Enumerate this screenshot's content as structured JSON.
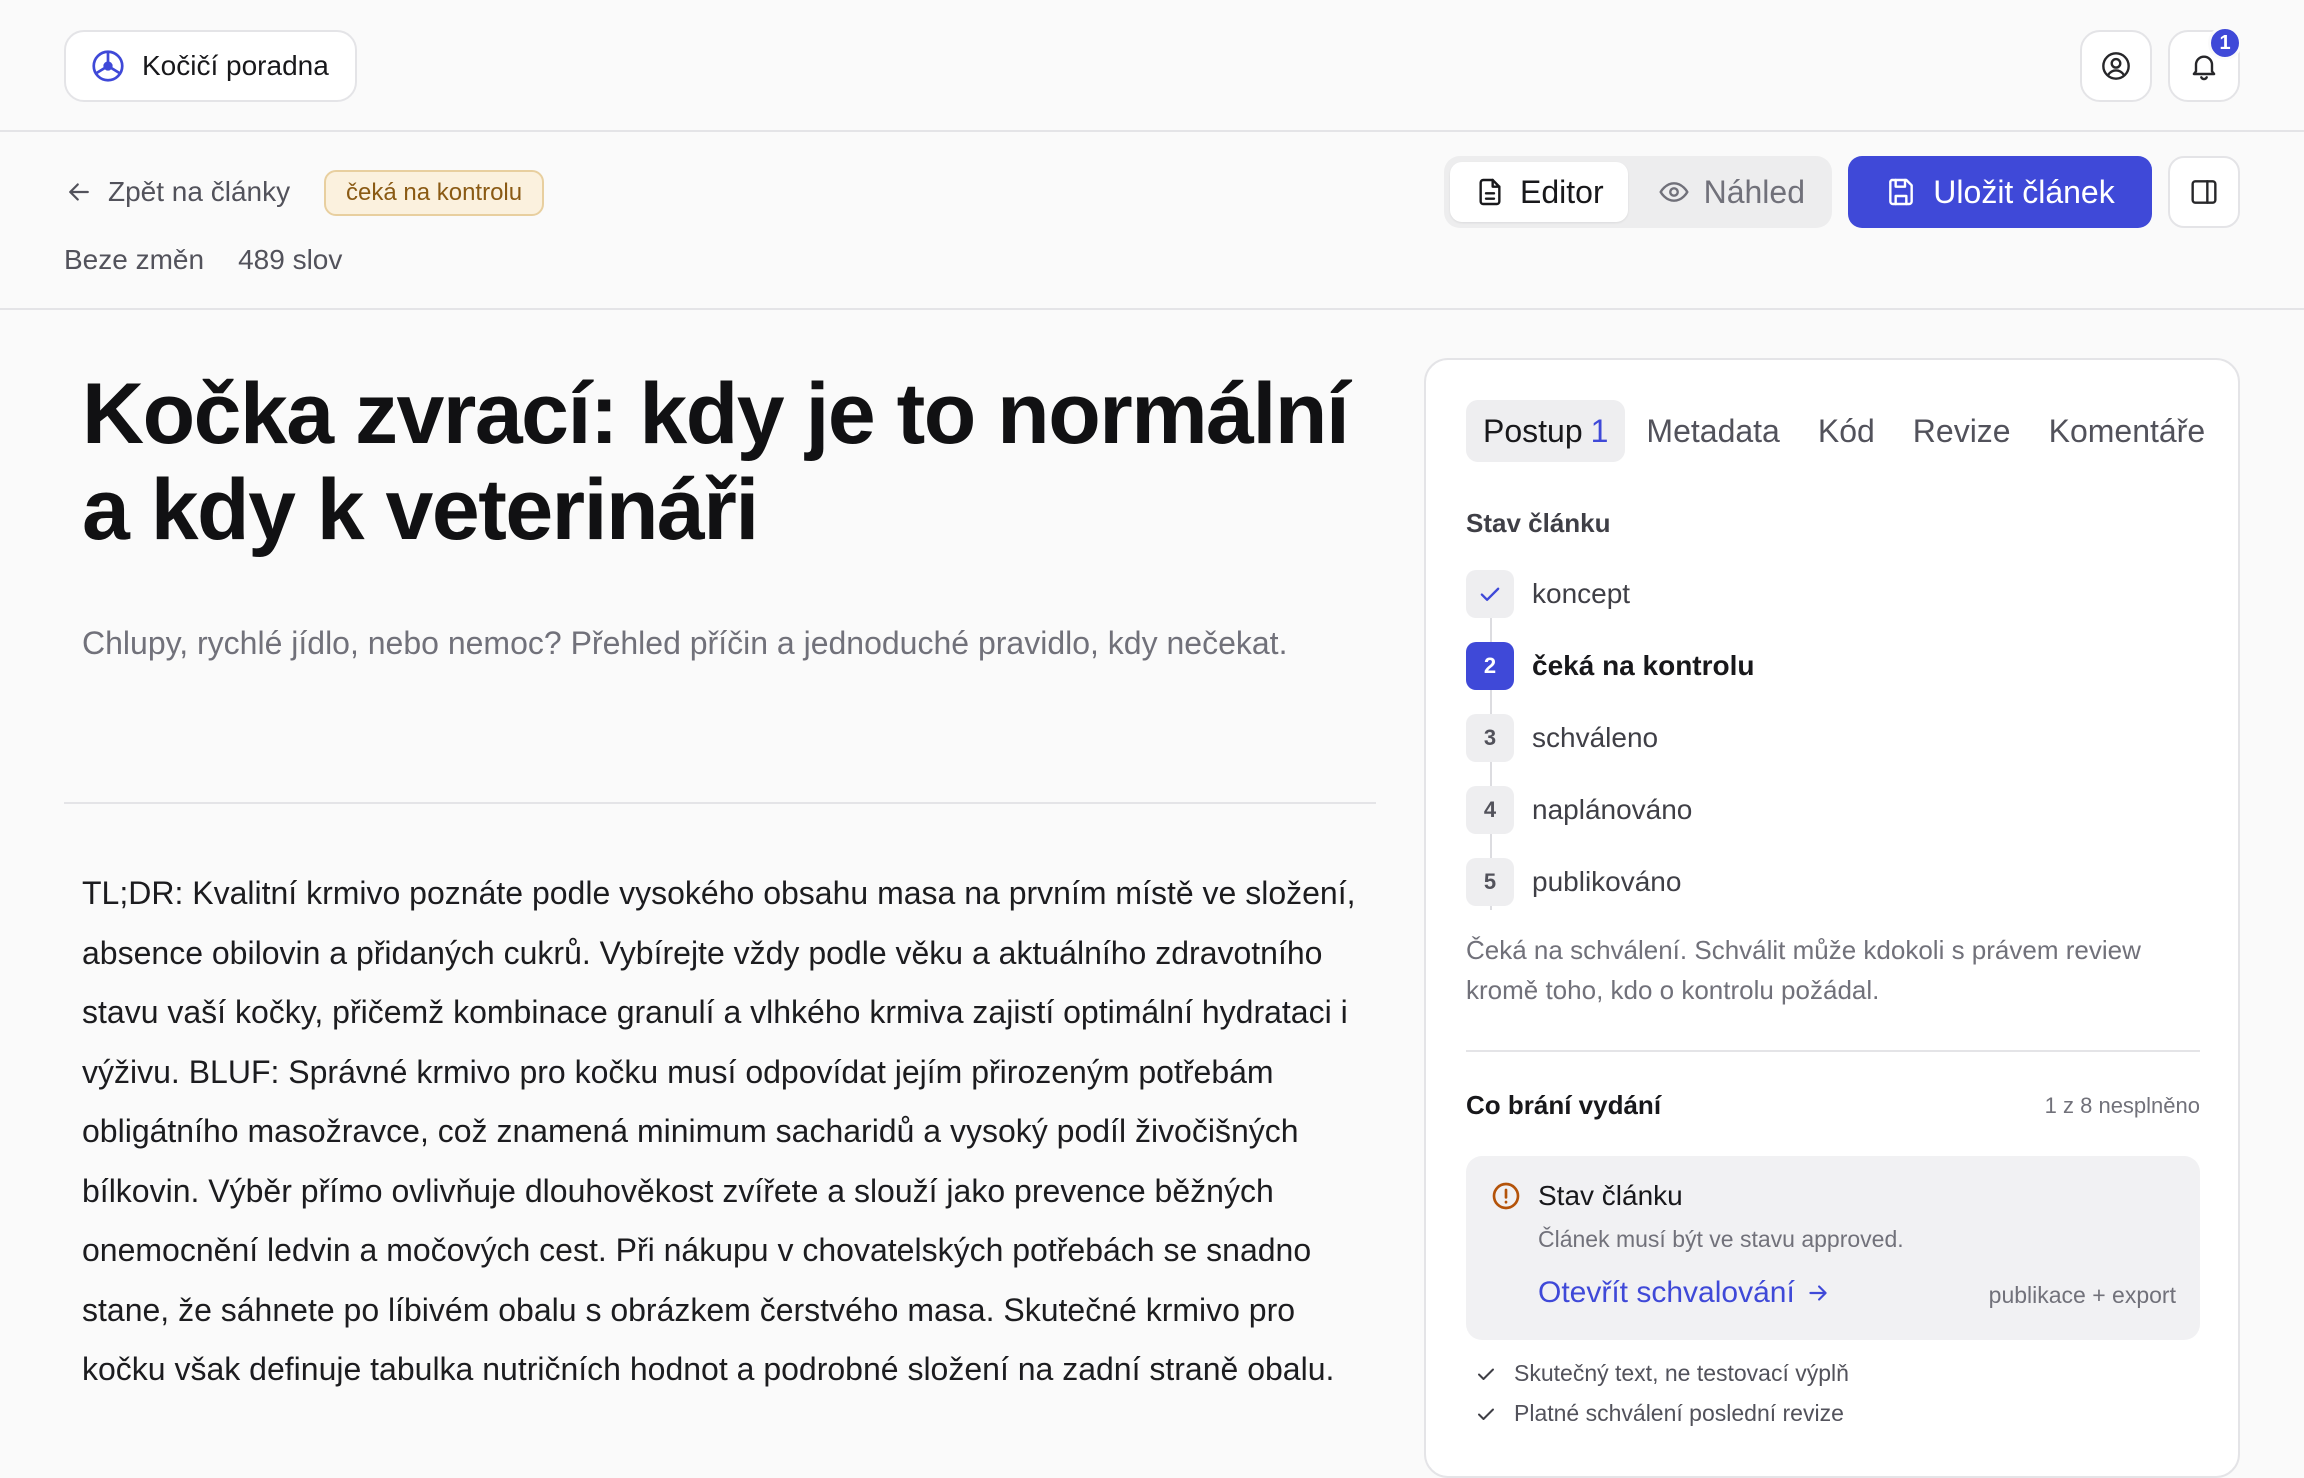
{
  "header": {
    "brand_label": "Kočičí poradna",
    "notification_count": "1"
  },
  "subheader": {
    "back_label": "Zpět na články",
    "status_badge": "čeká na kontrolu",
    "change_status": "Beze změn",
    "word_count": "489 slov",
    "mode_editor": "Editor",
    "mode_preview": "Náhled",
    "save_label": "Uložit článek"
  },
  "article": {
    "title": "Kočka zvrací: kdy je to normální a kdy k veterináři",
    "subtitle": "Chlupy, rychlé jídlo, nebo nemoc? Přehled příčin a jednoduché pravidlo, kdy nečekat.",
    "body": "TL;DR: Kvalitní krmivo poznáte podle vysokého obsahu masa na prvním místě ve složení, absence obilovin a přidaných cukrů. Vybírejte vždy podle věku a aktuálního zdravotního stavu vaší kočky, přičemž kombinace granulí a vlhkého krmiva zajistí optimální hydrataci i výživu. BLUF: Správné krmivo pro kočku musí odpovídat jejím přirozeným potřebám obligátního masožravce, což znamená minimum sacharidů a vysoký podíl živočišných bílkovin. Výběr přímo ovlivňuje dlouhověkost zvířete a slouží jako prevence běžných onemocnění ledvin a močových cest. Při nákupu v chovatelských potřebách se snadno stane, že sáhnete po líbivém obalu s obrázkem čerstvého masa. Skutečné krmivo pro kočku však definuje tabulka nutričních hodnot a podrobné složení na zadní straně obalu."
  },
  "sidebar": {
    "tabs": [
      {
        "label": "Postup",
        "count": "1"
      },
      {
        "label": "Metadata"
      },
      {
        "label": "Kód"
      },
      {
        "label": "Revize"
      },
      {
        "label": "Komentáře"
      }
    ],
    "status_heading": "Stav článku",
    "steps": [
      {
        "number": "",
        "label": "koncept",
        "state": "done"
      },
      {
        "number": "2",
        "label": "čeká na kontrolu",
        "state": "current"
      },
      {
        "number": "3",
        "label": "schváleno",
        "state": "pending"
      },
      {
        "number": "4",
        "label": "naplánováno",
        "state": "pending"
      },
      {
        "number": "5",
        "label": "publikováno",
        "state": "pending"
      }
    ],
    "status_description": "Čeká na schválení. Schválit může kdokoli s právem review kromě toho, kdo o kontrolu požádal.",
    "blockers": {
      "heading": "Co brání vydání",
      "count": "1 z 8 nesplněno",
      "item_title": "Stav článku",
      "item_detail": "Článek musí být ve stavu approved.",
      "item_action": "Otevřít schvalování",
      "item_scope": "publikace + export"
    },
    "checks": [
      "Skutečný text, ne testovací výplň",
      "Platné schválení poslední revize"
    ]
  },
  "colors": {
    "accent": "#3f49d8",
    "warning_text": "#8a5a14",
    "warning_bg": "#fbf1de"
  },
  "icons": {
    "brand": "cat-paw-logo-icon",
    "account": "user-circle-icon",
    "notifications": "bell-icon",
    "back": "arrow-left-icon",
    "editor": "document-icon",
    "preview": "eye-icon",
    "save": "floppy-disk-icon",
    "panel": "sidebar-panel-icon",
    "warning": "alert-circle-icon",
    "check": "check-icon"
  }
}
